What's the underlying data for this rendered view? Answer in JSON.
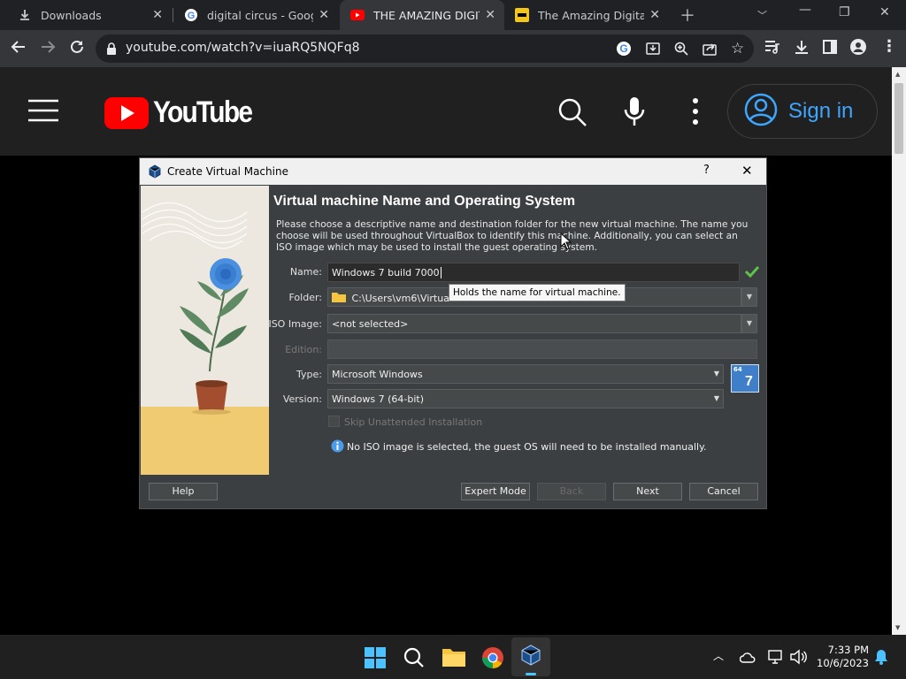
{
  "browser": {
    "tabs": [
      {
        "title": "Downloads"
      },
      {
        "title": "digital circus - Google"
      },
      {
        "title": "THE AMAZING DIGITA"
      },
      {
        "title": "The Amazing Digital C"
      }
    ],
    "url": "youtube.com/watch?v=iuaRQ5NQFq8"
  },
  "youtube": {
    "logo_text": "YouTube",
    "sign_in": "Sign in"
  },
  "dialog": {
    "window_title": "Create Virtual Machine",
    "help_glyph": "?",
    "heading": "Virtual machine Name and Operating System",
    "description": "Please choose a descriptive name and destination folder for the new virtual machine. The name you choose will be used throughout VirtualBox to identify this machine. Additionally, you can select an ISO image which may be used to install the guest operating system.",
    "fields": {
      "name_label": "Name:",
      "name_value": "Windows 7 build 7000",
      "folder_label": "Folder:",
      "folder_value": "C:\\Users\\vm6\\VirtualBox",
      "tooltip": "Holds the name for virtual machine.",
      "iso_label": "ISO Image:",
      "iso_value": "<not selected>",
      "edition_label": "Edition:",
      "type_label": "Type:",
      "type_value": "Microsoft Windows",
      "version_label": "Version:",
      "version_value": "Windows 7 (64-bit)",
      "os_badge": "7",
      "os_badge_bits": "64"
    },
    "skip_unattended": "Skip Unattended Installation",
    "info_text": "No ISO image is selected, the guest OS will need to be installed manually.",
    "buttons": {
      "help": "Help",
      "expert": "Expert Mode",
      "back": "Back",
      "next": "Next",
      "cancel": "Cancel"
    }
  },
  "taskbar": {
    "time": "7:33 PM",
    "date": "10/6/2023"
  },
  "colors": {
    "youtube_red": "#ff0000",
    "signin_blue": "#3ea6ff",
    "valid_green": "#5fc24b"
  }
}
